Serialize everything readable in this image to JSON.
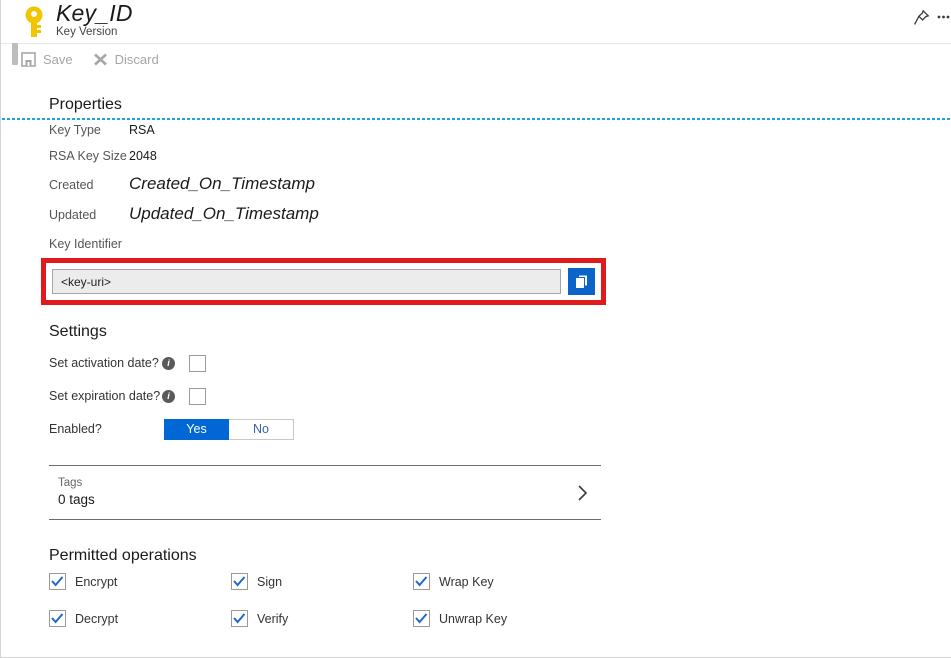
{
  "header": {
    "title": "Key_ID",
    "subtitle": "Key Version",
    "icon": "key-icon",
    "pin_icon": "pin-icon",
    "more_icon": "ellipsis-icon"
  },
  "toolbar": {
    "save_label": "Save",
    "save_icon": "save-disk-icon",
    "discard_label": "Discard",
    "discard_icon": "close-x-icon"
  },
  "properties": {
    "title": "Properties",
    "rows": [
      {
        "label": "Key Type",
        "value": "RSA"
      },
      {
        "label": "RSA Key Size",
        "value": "2048"
      },
      {
        "label": "Created",
        "value": "Created_On_Timestamp"
      },
      {
        "label": "Updated",
        "value": "Updated_On_Timestamp"
      }
    ],
    "key_identifier_label": "Key Identifier",
    "key_identifier_value": "<key-uri>",
    "copy_icon": "copy-pages-icon"
  },
  "settings": {
    "title": "Settings",
    "activation": {
      "label": "Set activation date?",
      "info_icon": "info-icon",
      "checked": false
    },
    "expiration": {
      "label": "Set expiration date?",
      "info_icon": "info-icon",
      "checked": false
    },
    "enabled": {
      "label": "Enabled?",
      "yes_label": "Yes",
      "no_label": "No",
      "selected": "Yes"
    }
  },
  "tags": {
    "label": "Tags",
    "value": "0 tags",
    "chevron_icon": "chevron-right-icon"
  },
  "permitted_operations": {
    "title": "Permitted operations",
    "items": [
      {
        "label": "Encrypt",
        "checked": true
      },
      {
        "label": "Sign",
        "checked": true
      },
      {
        "label": "Wrap Key",
        "checked": true
      },
      {
        "label": "Decrypt",
        "checked": true
      },
      {
        "label": "Verify",
        "checked": true
      },
      {
        "label": "Unwrap Key",
        "checked": true
      }
    ]
  },
  "colors": {
    "accent_blue": "#0067d5",
    "copy_button_blue": "#0c64c8",
    "highlight_red": "#e01b1b",
    "key_gold": "#f0c419",
    "dotted_rule_cyan": "#17a7e0",
    "disabled_gray": "#a6a6a6"
  }
}
